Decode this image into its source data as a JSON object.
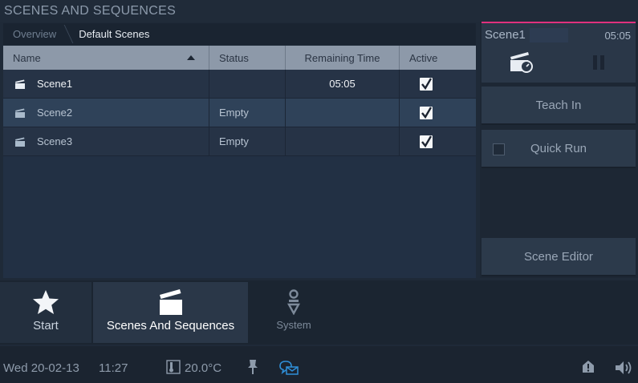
{
  "header": {
    "title": "SCENES AND SEQUENCES"
  },
  "breadcrumb": {
    "items": [
      "Overview",
      "Default Scenes"
    ]
  },
  "table": {
    "columns": [
      "Name",
      "Status",
      "Remaining Time",
      "Active"
    ],
    "rows": [
      {
        "name": "Scene1",
        "status": "",
        "remaining": "05:05",
        "active": true
      },
      {
        "name": "Scene2",
        "status": "Empty",
        "remaining": "",
        "active": true
      },
      {
        "name": "Scene3",
        "status": "Empty",
        "remaining": "",
        "active": true
      }
    ]
  },
  "scene_card": {
    "name": "Scene1",
    "time": "05:05",
    "accent": "#e0317d"
  },
  "buttons": {
    "teach_in": "Teach In",
    "quick_run": "Quick Run",
    "scene_editor": "Scene Editor"
  },
  "nav": {
    "start": "Start",
    "scenes": "Scenes And Sequences",
    "system": "System"
  },
  "status_bar": {
    "date": "Wed 20-02-13",
    "time": "11:27",
    "temperature": "20.0°C"
  },
  "icons": {
    "row": "clapperboard-icon",
    "card": "clapperboard-timer-icon",
    "pause": "pause-icon",
    "start": "star-icon",
    "scenes": "clapperboard-icon",
    "system": "system-icon",
    "temp": "thermometer-icon",
    "pin": "pin-icon",
    "msg": "message-icon",
    "notif": "notification-icon",
    "vol": "speaker-icon"
  }
}
